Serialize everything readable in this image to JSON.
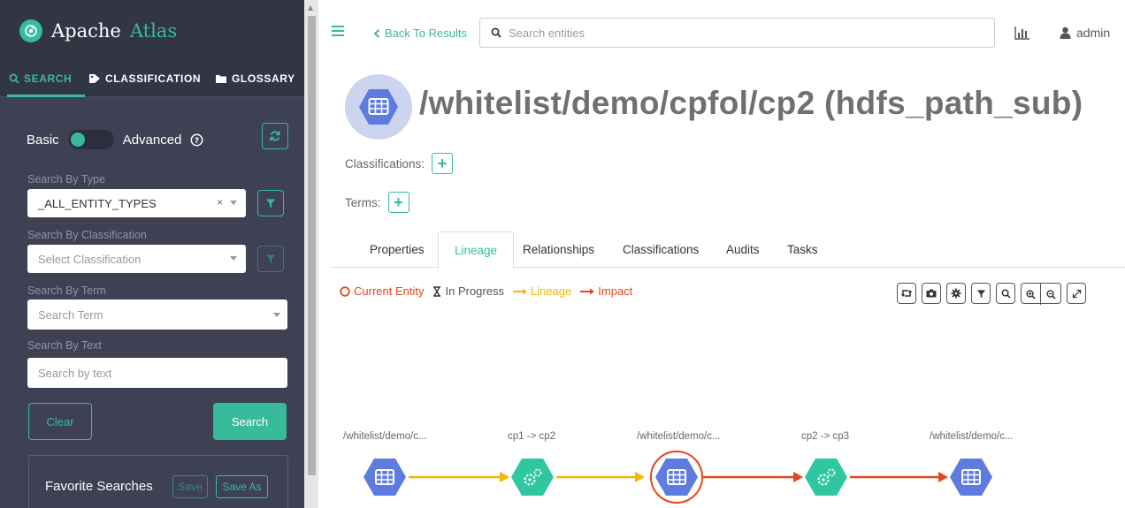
{
  "app": {
    "name_part1": "Apache",
    "name_part2": "Atlas"
  },
  "sidebar": {
    "tabs": [
      {
        "label": "SEARCH",
        "icon": "search-icon"
      },
      {
        "label": "CLASSIFICATION",
        "icon": "tag-icon"
      },
      {
        "label": "GLOSSARY",
        "icon": "folder-icon"
      }
    ],
    "basic_label": "Basic",
    "advanced_label": "Advanced",
    "search_by_type": {
      "label": "Search By Type",
      "value": "_ALL_ENTITY_TYPES"
    },
    "search_by_classification": {
      "label": "Search By Classification",
      "placeholder": "Select Classification"
    },
    "search_by_term": {
      "label": "Search By Term",
      "placeholder": "Search Term"
    },
    "search_by_text": {
      "label": "Search By Text",
      "placeholder": "Search by text"
    },
    "clear_label": "Clear",
    "search_label": "Search",
    "favorites": {
      "title": "Favorite Searches",
      "save_label": "Save",
      "save_as_label": "Save As"
    }
  },
  "header": {
    "back_label": "Back To Results",
    "search_placeholder": "Search entities",
    "user": "admin"
  },
  "entity": {
    "title": "/whitelist/demo/cpfol/cp2 (hdfs_path_sub)",
    "classifications_label": "Classifications:",
    "terms_label": "Terms:"
  },
  "tabs": [
    "Properties",
    "Lineage",
    "Relationships",
    "Classifications",
    "Audits",
    "Tasks"
  ],
  "active_tab": "Lineage",
  "legend": {
    "current_entity": "Current Entity",
    "in_progress": "In Progress",
    "lineage": "Lineage",
    "impact": "Impact"
  },
  "lineage_nodes": [
    {
      "label": "/whitelist/demo/c...",
      "kind": "dataset"
    },
    {
      "label": "cp1 -> cp2",
      "kind": "process"
    },
    {
      "label": "/whitelist/demo/c...",
      "kind": "dataset",
      "current": true
    },
    {
      "label": "cp2 -> cp3",
      "kind": "process"
    },
    {
      "label": "/whitelist/demo/c...",
      "kind": "dataset"
    }
  ],
  "colors": {
    "accent": "#37bb9b",
    "sidebar_bg": "#323544",
    "lineage_edge": "#f5b800",
    "impact_edge": "#e8461c",
    "dataset_node": "#5e7be0",
    "process_node": "#2fc7a1"
  }
}
